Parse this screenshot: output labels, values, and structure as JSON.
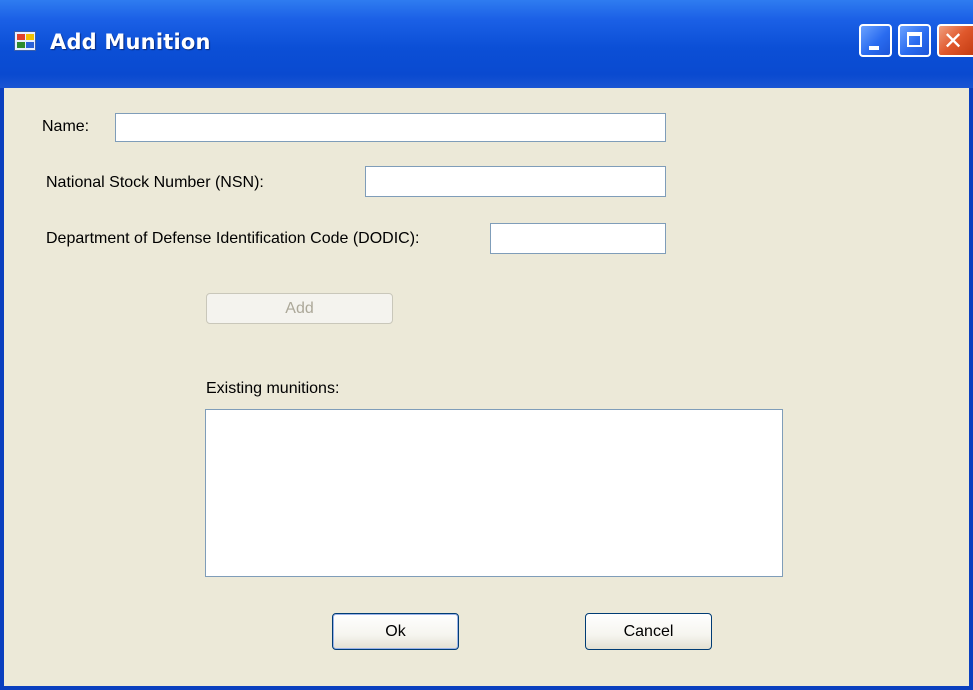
{
  "window": {
    "title": "Add Munition",
    "title_icon": "form-icon",
    "controls": {
      "minimize_icon": "minimize-icon",
      "maximize_icon": "maximize-icon",
      "close_icon": "close-icon",
      "close_glyph": "✕"
    },
    "accent_color": "#0a4ad0"
  },
  "form": {
    "name_label": "Name:",
    "name_value": "",
    "nsn_label": "National Stock Number (NSN):",
    "nsn_value": "",
    "dodic_label": "Department of Defense Identification Code (DODIC):",
    "dodic_value": "",
    "add_label": "Add",
    "existing_label": "Existing munitions:",
    "existing_items": []
  },
  "footer": {
    "ok_label": "Ok",
    "cancel_label": "Cancel"
  }
}
